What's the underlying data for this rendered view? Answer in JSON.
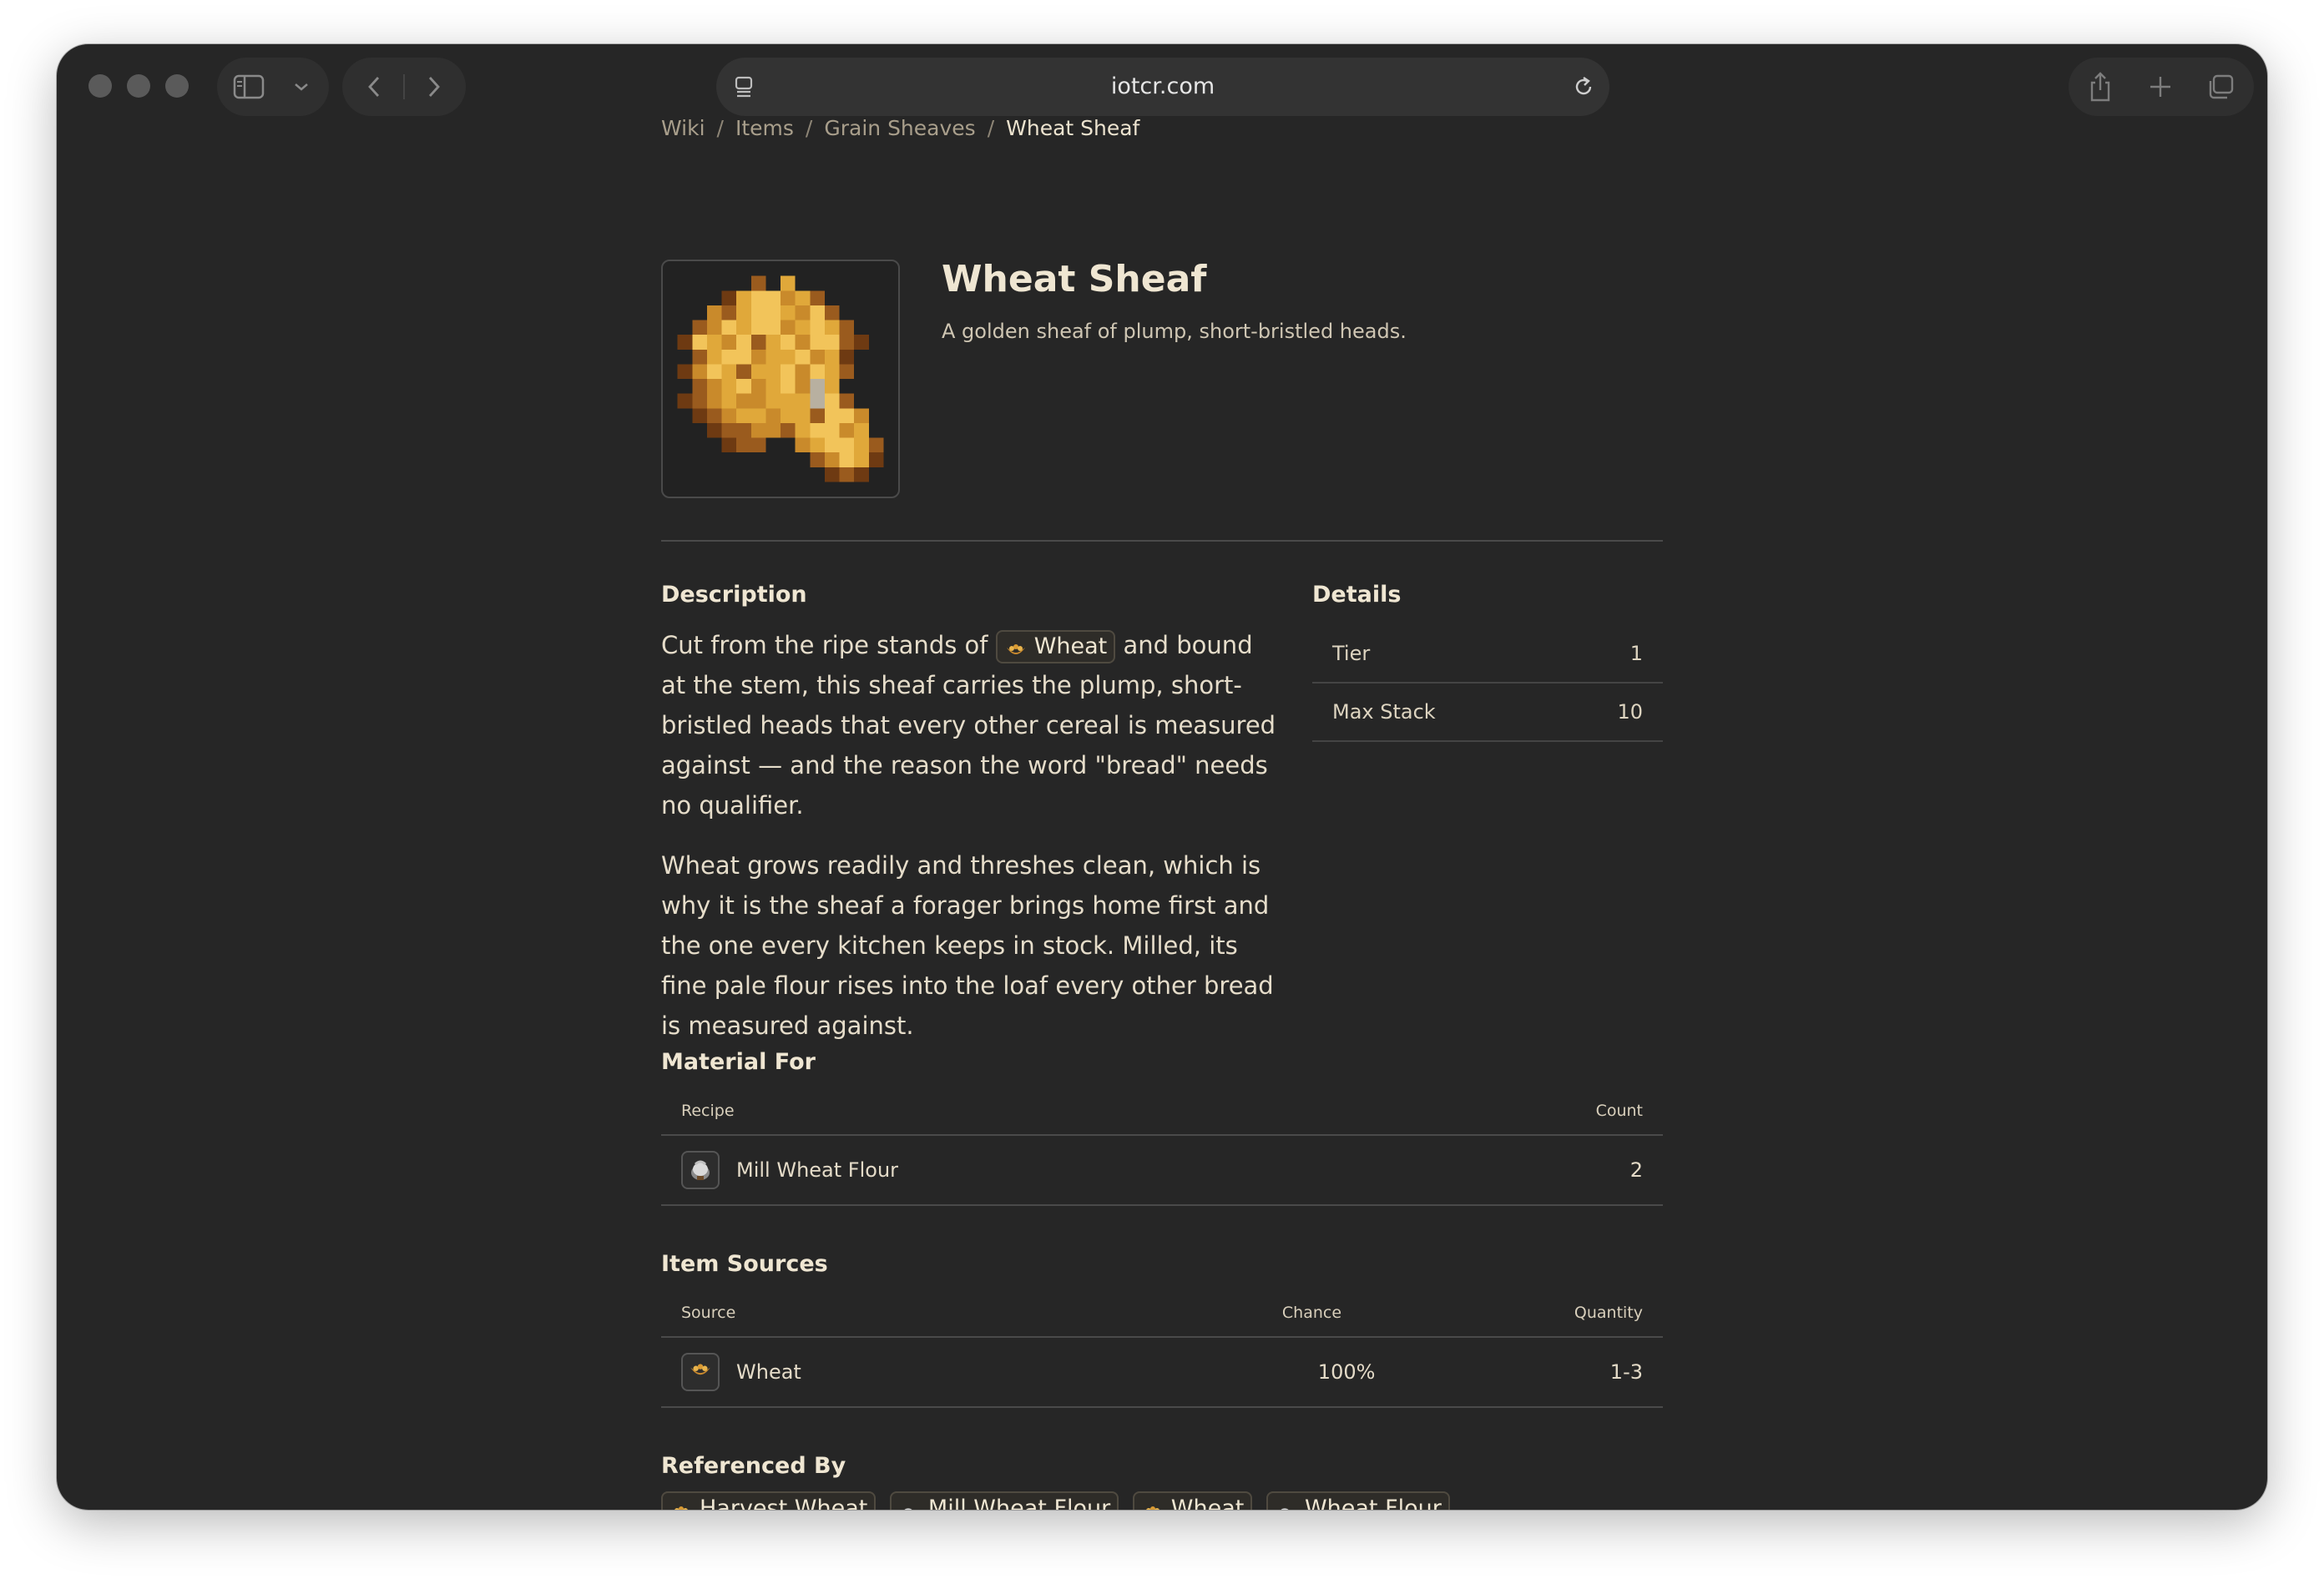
{
  "browser": {
    "url": "iotcr.com"
  },
  "breadcrumb": [
    "Wiki",
    "Items",
    "Grain Sheaves",
    "Wheat Sheaf"
  ],
  "item": {
    "title": "Wheat Sheaf",
    "subtitle": "A golden sheaf of plump, short-bristled heads."
  },
  "description": {
    "heading": "Description",
    "p1_before": "Cut from the ripe stands of ",
    "p1_link": "Wheat",
    "p1_after": " and bound at the stem, this sheaf carries the plump, short-bristled heads that every other cereal is measured against — and the reason the word \"bread\" needs no qualifier.",
    "p2": "Wheat grows readily and threshes clean, which is why it is the sheaf a forager brings home first and the one every kitchen keeps in stock. Milled, its fine pale flour rises into the loaf every other bread is measured against."
  },
  "details": {
    "heading": "Details",
    "rows": [
      {
        "label": "Tier",
        "value": "1"
      },
      {
        "label": "Max Stack",
        "value": "10"
      }
    ]
  },
  "material_for": {
    "heading": "Material For",
    "col_recipe": "Recipe",
    "col_count": "Count",
    "rows": [
      {
        "recipe": "Mill Wheat Flour",
        "count": "2",
        "icon": "flour-sack-icon"
      }
    ]
  },
  "item_sources": {
    "heading": "Item Sources",
    "col_source": "Source",
    "col_chance": "Chance",
    "col_quantity": "Quantity",
    "rows": [
      {
        "source": "Wheat",
        "chance": "100%",
        "quantity": "1-3",
        "icon": "wheat-icon"
      }
    ]
  },
  "referenced_by": {
    "heading": "Referenced By",
    "items": [
      "Harvest Wheat",
      "Mill Wheat Flour",
      "Wheat",
      "Wheat Flour"
    ]
  },
  "colors": {
    "background": "#262626",
    "text": "#e8dfcb",
    "gold": "#e0a83a"
  }
}
